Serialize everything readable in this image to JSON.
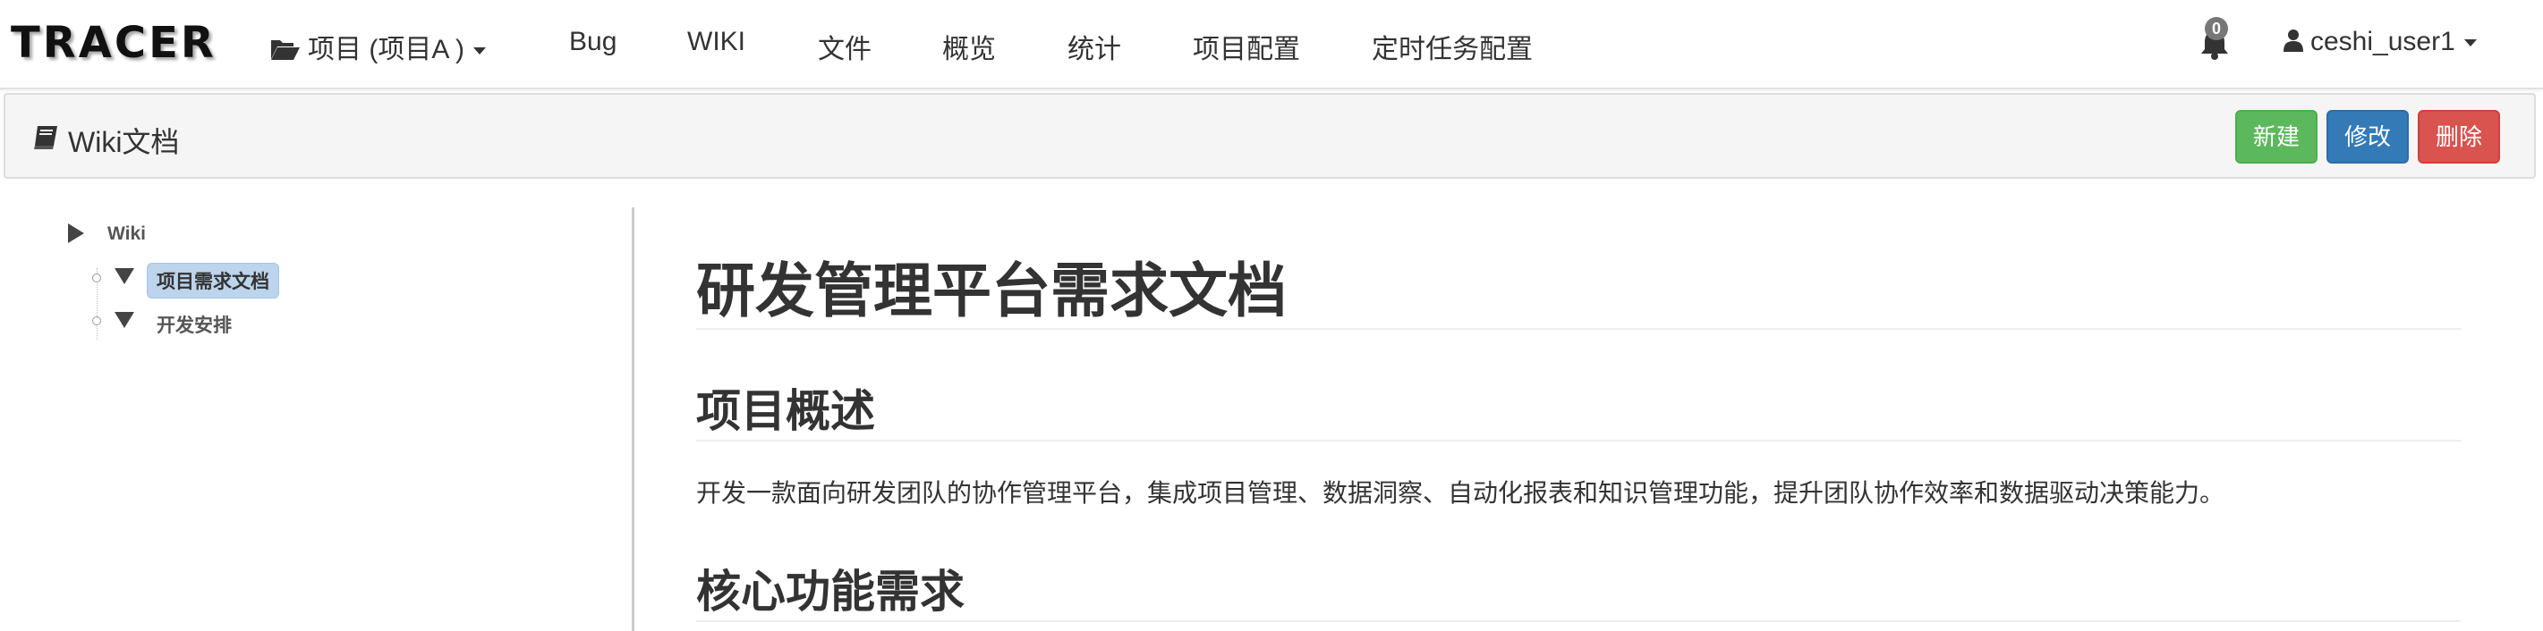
{
  "navbar": {
    "logo": "TRACER",
    "project_menu": "项目 (项目A )",
    "items": [
      "Bug",
      "WIKI",
      "文件",
      "概览",
      "统计",
      "项目配置",
      "定时任务配置"
    ],
    "notification_count": "0",
    "user": "ceshi_user1"
  },
  "header": {
    "title": "Wiki文档",
    "buttons": {
      "new": "新建",
      "edit": "修改",
      "delete": "删除"
    }
  },
  "tree": {
    "root": "Wiki",
    "children": [
      {
        "label": "项目需求文档",
        "selected": true
      },
      {
        "label": "开发安排",
        "selected": false
      }
    ]
  },
  "document": {
    "title": "研发管理平台需求文档",
    "sections": [
      {
        "heading": "项目概述",
        "body": "开发一款面向研发团队的协作管理平台，集成项目管理、数据洞察、自动化报表和知识管理功能，提升团队协作效率和数据驱动决策能力。"
      },
      {
        "heading": "核心功能需求"
      }
    ]
  },
  "colors": {
    "success": "#5cb85c",
    "primary": "#337ab7",
    "danger": "#d9534f",
    "selected_node": "#bcd4ec"
  }
}
